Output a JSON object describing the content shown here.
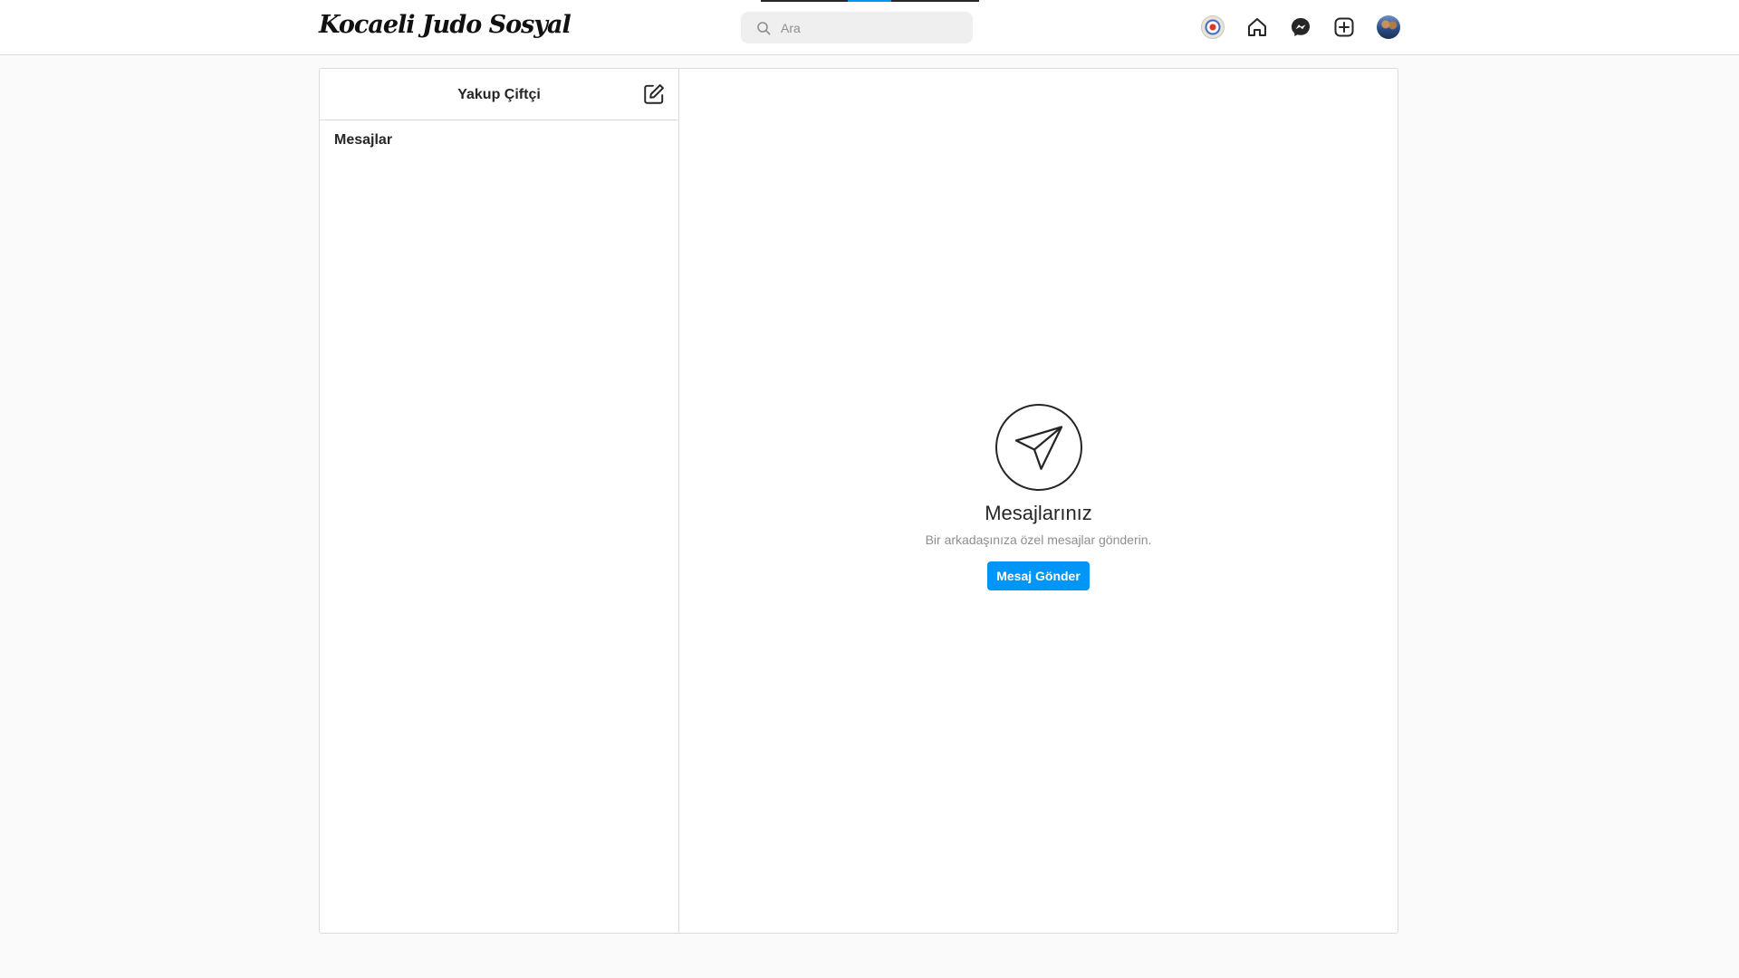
{
  "header": {
    "logo": "Kocaeli Judo Sosyal",
    "search": {
      "placeholder": "Ara",
      "value": ""
    },
    "icons": [
      "club-emblem-icon",
      "home-icon",
      "messenger-icon",
      "new-post-icon",
      "profile-avatar"
    ]
  },
  "inbox": {
    "username": "Yakup Çiftçi",
    "section_label": "Mesajlar"
  },
  "empty_state": {
    "title": "Mesajlarınız",
    "subtitle": "Bir arkadaşınıza özel mesajlar gönderin.",
    "button_label": "Mesaj Gönder"
  },
  "colors": {
    "accent": "#0095f6",
    "border": "#dbdbdb",
    "background": "#fafafa",
    "text": "#262626",
    "muted_text": "#8e8e8e"
  }
}
